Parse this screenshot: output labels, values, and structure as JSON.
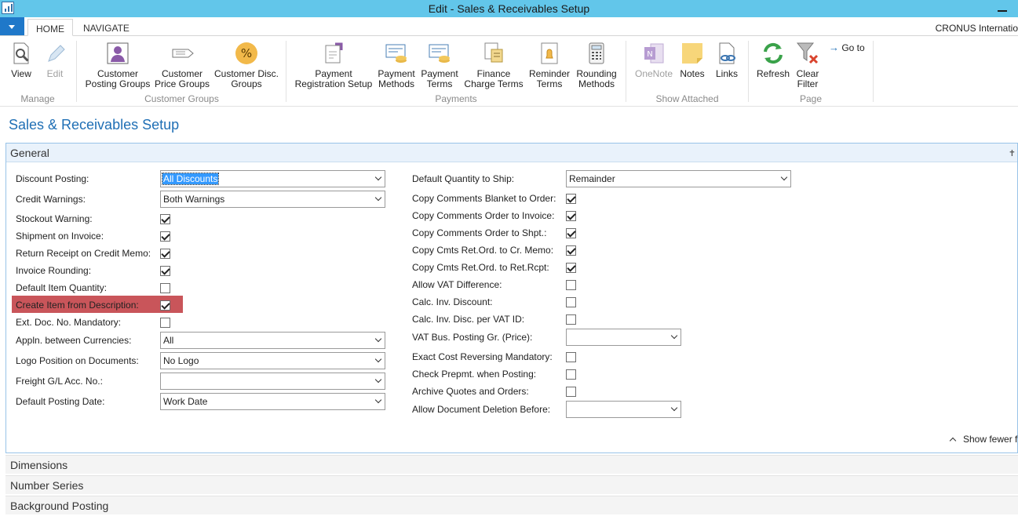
{
  "window": {
    "title": "Edit - Sales & Receivables Setup",
    "company": "CRONUS Internatio"
  },
  "tabs": [
    {
      "label": "HOME",
      "active": true
    },
    {
      "label": "NAVIGATE",
      "active": false
    }
  ],
  "ribbon": {
    "groups": [
      {
        "label": "Manage",
        "buttons": [
          {
            "label1": "View",
            "label2": "",
            "icon": "view-icon",
            "enabled": true
          },
          {
            "label1": "Edit",
            "label2": "",
            "icon": "edit-pencil-icon",
            "enabled": false
          }
        ]
      },
      {
        "label": "Customer Groups",
        "buttons": [
          {
            "label1": "Customer",
            "label2": "Posting Groups",
            "icon": "customer-posting-groups-icon",
            "enabled": true
          },
          {
            "label1": "Customer",
            "label2": "Price Groups",
            "icon": "price-tag-icon",
            "enabled": true
          },
          {
            "label1": "Customer Disc.",
            "label2": "Groups",
            "icon": "percent-icon",
            "enabled": true
          }
        ]
      },
      {
        "label": "Payments",
        "buttons": [
          {
            "label1": "Payment",
            "label2": "Registration Setup",
            "icon": "payment-registration-icon",
            "enabled": true
          },
          {
            "label1": "Payment",
            "label2": "Methods",
            "icon": "payment-methods-icon",
            "enabled": true
          },
          {
            "label1": "Payment",
            "label2": "Terms",
            "icon": "payment-terms-icon",
            "enabled": true
          },
          {
            "label1": "Finance",
            "label2": "Charge Terms",
            "icon": "finance-charge-icon",
            "enabled": true
          },
          {
            "label1": "Reminder",
            "label2": "Terms",
            "icon": "reminder-icon",
            "enabled": true
          },
          {
            "label1": "Rounding",
            "label2": "Methods",
            "icon": "calculator-icon",
            "enabled": true
          }
        ]
      },
      {
        "label": "Show Attached",
        "buttons": [
          {
            "label1": "OneNote",
            "label2": "",
            "icon": "onenote-icon",
            "enabled": false
          },
          {
            "label1": "Notes",
            "label2": "",
            "icon": "note-icon",
            "enabled": true
          },
          {
            "label1": "Links",
            "label2": "",
            "icon": "link-icon",
            "enabled": true
          }
        ]
      },
      {
        "label": "Page",
        "buttons": [
          {
            "label1": "Refresh",
            "label2": "",
            "icon": "refresh-icon",
            "enabled": true
          },
          {
            "label1": "Clear",
            "label2": "Filter",
            "icon": "clear-filter-icon",
            "enabled": true
          },
          {
            "label1": "Go to",
            "label2": "",
            "icon": "goto-arrow-icon",
            "enabled": true
          }
        ]
      }
    ]
  },
  "page_title": "Sales & Receivables Setup",
  "general": {
    "header": "General",
    "show_fewer": "Show fewer f",
    "left": [
      {
        "label": "Discount Posting:",
        "type": "select",
        "value": "All Discounts",
        "selected_text": true
      },
      {
        "label": "Credit Warnings:",
        "type": "select",
        "value": "Both Warnings"
      },
      {
        "label": "Stockout Warning:",
        "type": "checkbox",
        "checked": true
      },
      {
        "label": "Shipment on Invoice:",
        "type": "checkbox",
        "checked": true
      },
      {
        "label": "Return Receipt on Credit Memo:",
        "type": "checkbox",
        "checked": true
      },
      {
        "label": "Invoice Rounding:",
        "type": "checkbox",
        "checked": true
      },
      {
        "label": "Default Item Quantity:",
        "type": "checkbox",
        "checked": false
      },
      {
        "label": "Create Item from Description:",
        "type": "checkbox",
        "checked": true,
        "highlighted": true
      },
      {
        "label": "Ext. Doc. No. Mandatory:",
        "type": "checkbox",
        "checked": false
      },
      {
        "label": "Appln. between Currencies:",
        "type": "select",
        "value": "All"
      },
      {
        "label": "Logo Position on Documents:",
        "type": "select",
        "value": "No Logo"
      },
      {
        "label": "Freight G/L Acc. No.:",
        "type": "select",
        "value": ""
      },
      {
        "label": "Default Posting Date:",
        "type": "select",
        "value": "Work Date"
      }
    ],
    "right": [
      {
        "label": "Default Quantity to Ship:",
        "type": "select",
        "value": "Remainder"
      },
      {
        "label": "Copy Comments Blanket to Order:",
        "type": "checkbox",
        "checked": true
      },
      {
        "label": "Copy Comments Order to Invoice:",
        "type": "checkbox",
        "checked": true
      },
      {
        "label": "Copy Comments Order to Shpt.:",
        "type": "checkbox",
        "checked": true
      },
      {
        "label": "Copy Cmts Ret.Ord. to Cr. Memo:",
        "type": "checkbox",
        "checked": true
      },
      {
        "label": "Copy Cmts Ret.Ord. to Ret.Rcpt:",
        "type": "checkbox",
        "checked": true
      },
      {
        "label": "Allow VAT Difference:",
        "type": "checkbox",
        "checked": false
      },
      {
        "label": "Calc. Inv. Discount:",
        "type": "checkbox",
        "checked": false
      },
      {
        "label": "Calc. Inv. Disc. per VAT ID:",
        "type": "checkbox",
        "checked": false
      },
      {
        "label": "VAT Bus. Posting Gr. (Price):",
        "type": "select",
        "value": ""
      },
      {
        "label": "Exact Cost Reversing Mandatory:",
        "type": "checkbox",
        "checked": false
      },
      {
        "label": "Check Prepmt. when Posting:",
        "type": "checkbox",
        "checked": false
      },
      {
        "label": "Archive Quotes and Orders:",
        "type": "checkbox",
        "checked": false
      },
      {
        "label": "Allow Document Deletion Before:",
        "type": "select",
        "value": ""
      }
    ]
  },
  "fasttabs": [
    "Dimensions",
    "Number Series",
    "Background Posting"
  ],
  "colors": {
    "titlebar": "#62c6ea",
    "accent": "#1f78c9",
    "page_title": "#1f6fb5",
    "highlight": "#c9555a"
  }
}
